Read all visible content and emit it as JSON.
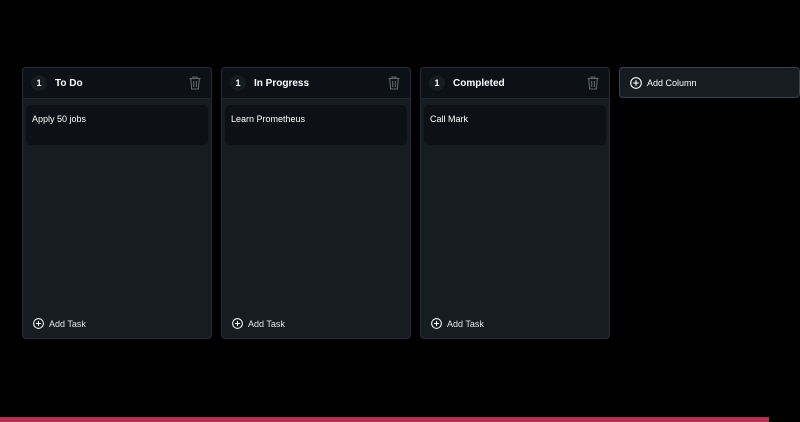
{
  "board": {
    "columns": [
      {
        "count": "1",
        "title": "To Do",
        "tasks": [
          "Apply 50 jobs"
        ],
        "add_task_label": "Add Task"
      },
      {
        "count": "1",
        "title": "In Progress",
        "tasks": [
          "Learn Prometheus"
        ],
        "add_task_label": "Add Task"
      },
      {
        "count": "1",
        "title": "Completed",
        "tasks": [
          "Call Mark"
        ],
        "add_task_label": "Add Task"
      }
    ],
    "add_column_label": "Add Column"
  },
  "icons": {
    "delete": "trash-icon",
    "add": "plus-circle-icon"
  },
  "colors": {
    "background": "#000000",
    "column": "#161c22",
    "header": "#0d1117",
    "card": "#0d1117",
    "scrollbar": "#b03052"
  }
}
